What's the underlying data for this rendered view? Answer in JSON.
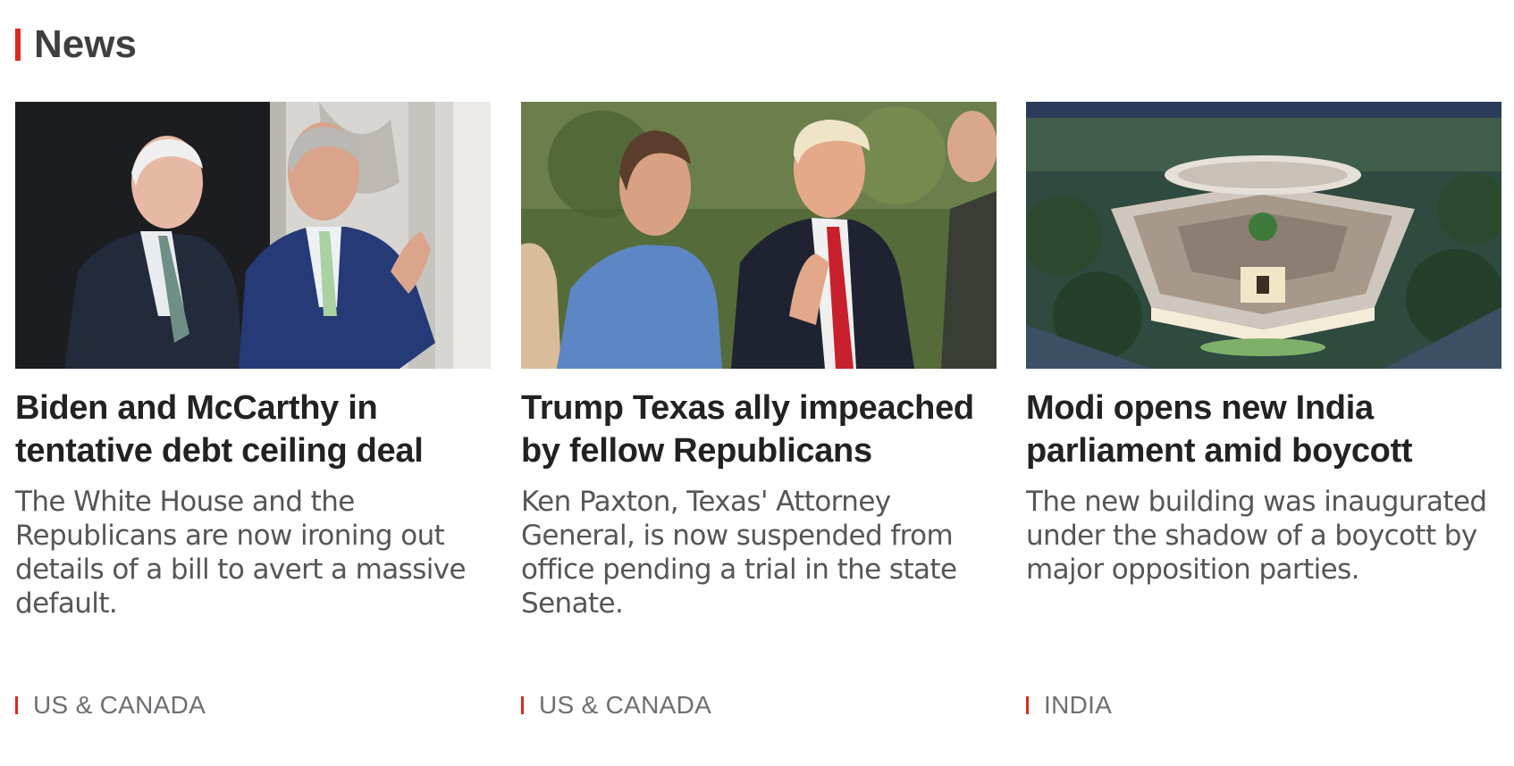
{
  "section": {
    "title": "News",
    "accent_color": "#e0281e"
  },
  "cards": [
    {
      "image_alt": "Joe Biden and Kevin McCarthy",
      "headline": "Biden and McCarthy in tentative debt ceiling deal",
      "summary": "The White House and the Republicans are now ironing out details of a bill to avert a massive default.",
      "tag": "US & CANADA"
    },
    {
      "image_alt": "Ken Paxton and Donald Trump",
      "headline": "Trump Texas ally impeached by fellow Republicans",
      "summary": "Ken Paxton, Texas' Attorney General, is now suspended from office pending a trial in the state Senate.",
      "tag": "US & CANADA"
    },
    {
      "image_alt": "New Indian parliament building",
      "headline": "Modi opens new India parliament amid boycott",
      "summary": "The new building was inaugurated under the shadow of a boycott by major opposition parties.",
      "tag": "INDIA"
    }
  ]
}
